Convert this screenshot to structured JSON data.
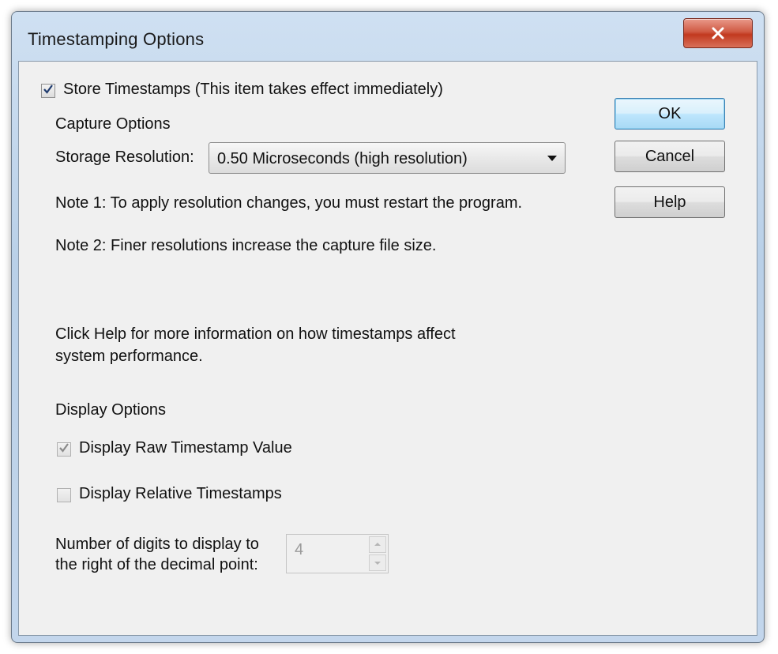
{
  "window": {
    "title": "Timestamping Options",
    "close_icon": "close-icon"
  },
  "store_timestamps": {
    "label": "Store Timestamps (This item takes effect immediately)",
    "checked": true
  },
  "capture_options": {
    "heading": "Capture Options",
    "storage_resolution_label": "Storage Resolution:",
    "storage_resolution_value": "0.50 Microseconds (high resolution)",
    "note1": "Note 1: To apply resolution changes, you must restart the program.",
    "note2": "Note 2: Finer resolutions increase the capture file size."
  },
  "help_text": {
    "line1": "Click Help for more information on how timestamps affect",
    "line2": "system performance."
  },
  "display_options": {
    "heading": "Display Options",
    "raw_timestamp": {
      "label": "Display Raw Timestamp Value",
      "checked": true,
      "enabled": false
    },
    "relative_timestamps": {
      "label": "Display Relative Timestamps",
      "checked": false,
      "enabled": false
    },
    "digits_label_line1": "Number of digits to display to",
    "digits_label_line2": "the right of the decimal point:",
    "digits_value": "4"
  },
  "buttons": {
    "ok": "OK",
    "cancel": "Cancel",
    "help": "Help"
  },
  "colors": {
    "title_bar": "#c3d6ec",
    "client_bg": "#f0f0f0",
    "close_button": "#c2391f",
    "default_button_border": "#3c7fb1"
  }
}
